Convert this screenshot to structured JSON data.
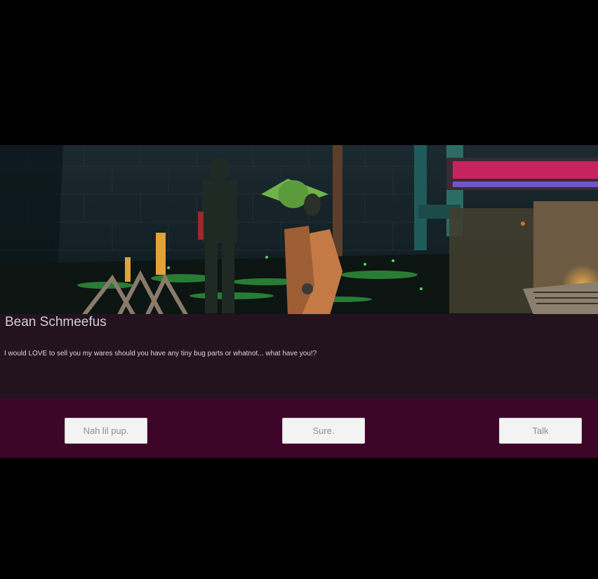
{
  "dialog": {
    "speaker": "Bean Schmeefus",
    "text": "I would LOVE to sell you my wares should you have any tiny bug parts or whatnot... what have you!?"
  },
  "choices": [
    {
      "label": "Nah lil pup."
    },
    {
      "label": "Sure."
    },
    {
      "label": "Talk"
    }
  ],
  "hud": {
    "health_fraction": 1.0,
    "stamina_fraction": 1.0,
    "health_color": "#c7245f",
    "stamina_color": "#6e58c4"
  },
  "colors": {
    "dialog_panel": "#23131f",
    "choice_panel": "#3d0628",
    "button_bg": "#f3f3f3",
    "button_text": "#8f8f8f"
  }
}
